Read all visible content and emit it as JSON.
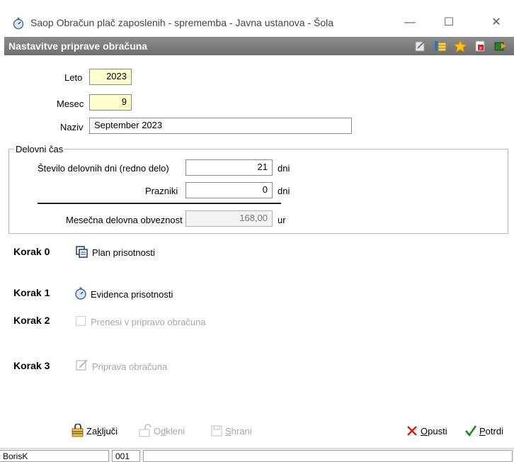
{
  "window": {
    "title": "Saop Obračun plač zaposlenih - sprememba - Javna ustanova - Šola",
    "minimize": "—",
    "maximize": "☐",
    "close": "✕"
  },
  "header": {
    "title": "Nastavitve priprave obračuna"
  },
  "form": {
    "leto_label": "Leto",
    "leto_value": "2023",
    "mesec_label": "Mesec",
    "mesec_value": "9",
    "naziv_label": "Naziv",
    "naziv_value": "September 2023"
  },
  "delovni_cas": {
    "title": "Delovni čas",
    "dni_label": "Število delovnih dni (redno delo)",
    "dni_value": "21",
    "dni_unit": "dni",
    "prazniki_label": "Prazniki",
    "prazniki_value": "0",
    "prazniki_unit": "dni",
    "obveznost_label": "Mesečna delovna obveznost",
    "obveznost_value": "168,00",
    "obveznost_unit": "ur"
  },
  "steps": [
    {
      "korak": "Korak 0",
      "label": "Plan prisotnosti",
      "icon": "plan-icon",
      "enabled": true
    },
    {
      "korak": "Korak 1",
      "label": "Evidenca prisotnosti",
      "icon": "stopwatch-icon",
      "enabled": true
    },
    {
      "korak": "Korak 2",
      "label": "Prenesi v pripravo obračuna",
      "icon": "checkbox",
      "enabled": false
    },
    {
      "korak": "Korak 3",
      "label": "Priprava obračuna",
      "icon": "edit-icon",
      "enabled": false
    }
  ],
  "buttons": {
    "zakljuci_pre": "Za",
    "zakljuci_u": "k",
    "zakljuci_post": "ljuči",
    "odkleni_pre": "O",
    "odkleni_u": "d",
    "odkleni_post": "kleni",
    "shrani_u": "S",
    "shrani_post": "hrani",
    "opusti_u": "O",
    "opusti_post": "pusti",
    "potrdi_u": "P",
    "potrdi_post": "otrdi"
  },
  "status": {
    "user": "BorisK",
    "code": "001"
  },
  "colors": {
    "header_bg": "#7a7a7a",
    "input_yellow": "#ffffd0",
    "cancel_red": "#d42020",
    "confirm_green": "#1a8a1a"
  }
}
